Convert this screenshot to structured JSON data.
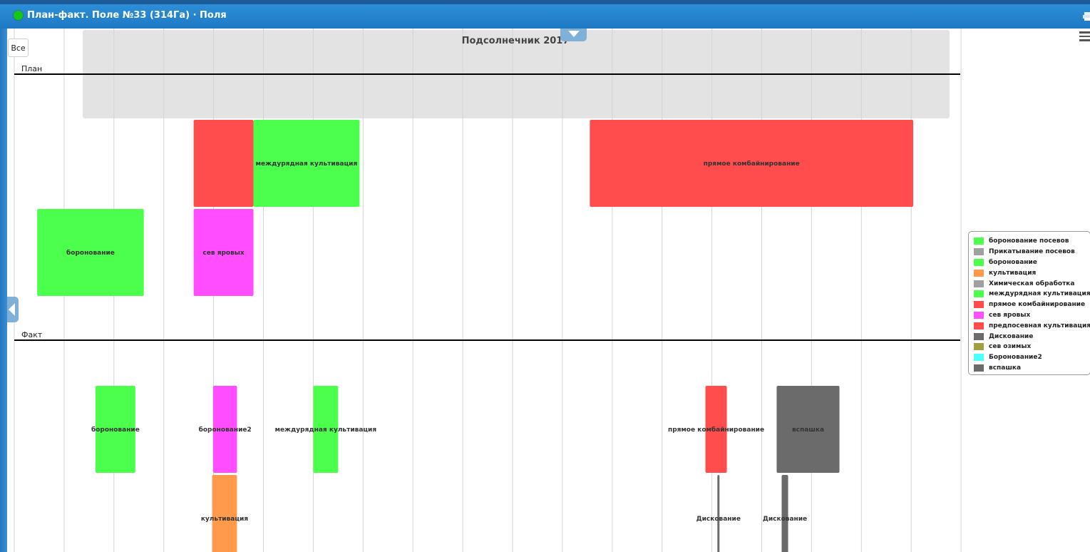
{
  "window": {
    "title": "План-факт. Поле №33 (314Га) · Поля",
    "status_color": "#16c716"
  },
  "toolbar": {
    "all_button_label": "Все",
    "menu_icon": "hamburger-menu-icon",
    "print_icon": "printer-icon"
  },
  "chart_data": {
    "type": "gantt",
    "crop_label": "Подсолнечник 2017",
    "row_labels": {
      "plan": "План",
      "fact": "Факт"
    },
    "time_axis": {
      "columns": 19,
      "tick_labels": []
    },
    "colors": {
      "green": "#4dff4d",
      "red": "#ff4d4d",
      "magenta": "#ff4dff",
      "orange": "#ff9a4d",
      "gray": "#6b6b6b",
      "lightgray": "#a0a0a0",
      "olive": "#a0a040",
      "cyan": "#4dffff",
      "crop_band": "#e3e3e3"
    },
    "plan_bars": [
      {
        "label": "",
        "start": 3.6,
        "end": 4.8,
        "lane": 0,
        "color": "#ff4d4d"
      },
      {
        "label": "междурядная культивация",
        "start": 4.8,
        "end": 6.93,
        "lane": 0,
        "color": "#4dff4d"
      },
      {
        "label": "прямое комбайнирование",
        "start": 11.55,
        "end": 18.04,
        "lane": 0,
        "color": "#ff4d4d"
      },
      {
        "label": "боронование",
        "start": 0.46,
        "end": 2.6,
        "lane": 1,
        "color": "#4dff4d"
      },
      {
        "label": "сев яровых",
        "start": 3.6,
        "end": 4.8,
        "lane": 1,
        "color": "#ff4dff"
      }
    ],
    "fact_bars": [
      {
        "label": "боронование",
        "start": 1.63,
        "end": 2.43,
        "lane": 0,
        "color": "#4dff4d"
      },
      {
        "label": "боронование2",
        "start": 3.99,
        "end": 4.47,
        "lane": 0,
        "color": "#ff4dff"
      },
      {
        "label": "междурядная культивация",
        "start": 6.0,
        "end": 6.5,
        "lane": 0,
        "color": "#4dff4d"
      },
      {
        "label": "прямое комбайнирование",
        "start": 13.87,
        "end": 14.3,
        "lane": 0,
        "color": "#ff4d4d"
      },
      {
        "label": "вспашка",
        "start": 15.3,
        "end": 16.56,
        "lane": 0,
        "color": "#6b6b6b"
      },
      {
        "label": "культивация",
        "start": 3.97,
        "end": 4.47,
        "lane": 1,
        "color": "#ff9a4d"
      },
      {
        "label": "Дискование",
        "start": 14.11,
        "end": 14.14,
        "lane": 1,
        "color": "#6b6b6b"
      },
      {
        "label": "Дискование",
        "start": 15.4,
        "end": 15.53,
        "lane": 1,
        "color": "#6b6b6b"
      }
    ],
    "legend": [
      {
        "label": "боронование посевов",
        "color": "#4dff4d"
      },
      {
        "label": "Прикатывание посевов",
        "color": "#a0a0a0"
      },
      {
        "label": "боронование",
        "color": "#4dff4d"
      },
      {
        "label": "культивация",
        "color": "#ff9a4d"
      },
      {
        "label": "Химическая обработка",
        "color": "#a0a0a0"
      },
      {
        "label": "междурядная культивация",
        "color": "#4dff4d"
      },
      {
        "label": "прямое комбайнирование",
        "color": "#ff4d4d"
      },
      {
        "label": "сев яровых",
        "color": "#ff4dff"
      },
      {
        "label": "предпосевная культивация",
        "color": "#ff4d4d"
      },
      {
        "label": "Дискование",
        "color": "#6b6b6b"
      },
      {
        "label": "сев озимых",
        "color": "#a0a040"
      },
      {
        "label": "Боронование2",
        "color": "#4dffff"
      },
      {
        "label": "вспашка",
        "color": "#6b6b6b"
      }
    ],
    "legend_position": "right"
  }
}
